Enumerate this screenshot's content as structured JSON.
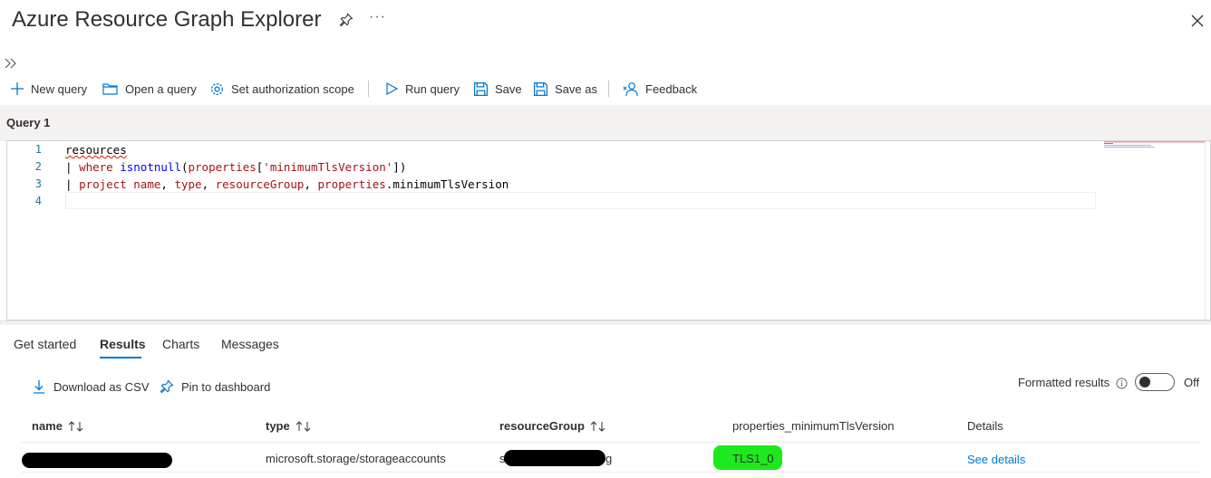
{
  "header": {
    "title": "Azure Resource Graph Explorer",
    "more_label": "···"
  },
  "toolbar": {
    "new_query": "New query",
    "open_query": "Open a query",
    "set_scope": "Set authorization scope",
    "run_query": "Run query",
    "save": "Save",
    "save_as": "Save as",
    "feedback": "Feedback"
  },
  "query_tab": {
    "label": "Query 1"
  },
  "editor": {
    "line_numbers": [
      "1",
      "2",
      "3",
      "4"
    ],
    "line1": "resources",
    "line2": {
      "pipe": "| ",
      "kw": "where",
      "fn": "isnotnull",
      "open": "(",
      "prop": "properties",
      "bracket_open": "[",
      "str": "'minimumTlsVersion'",
      "close": "])"
    },
    "line3": {
      "pipe": "| ",
      "kw": "project",
      "sp": " ",
      "a": "name",
      "c1": ", ",
      "b": "type",
      "c2": ", ",
      "c": "resourceGroup",
      "c3": ", ",
      "d": "properties",
      "e": ".minimumTlsVersion"
    }
  },
  "results_tabs": [
    "Get started",
    "Results",
    "Charts",
    "Messages"
  ],
  "actions": {
    "download_csv": "Download as CSV",
    "pin_dashboard": "Pin to dashboard"
  },
  "formatted": {
    "label": "Formatted results",
    "state_label": "Off",
    "enabled": false
  },
  "table": {
    "columns": [
      "name",
      "type",
      "resourceGroup",
      "properties_minimumTlsVersion",
      "Details"
    ],
    "rows": [
      {
        "name": "",
        "type": "microsoft.storage/storageaccounts",
        "resourceGroup_prefix": "s",
        "resourceGroup_suffix": "g",
        "tls": "TLS1_0",
        "details": "See details"
      }
    ]
  },
  "colors": {
    "accent": "#0078d4",
    "highlight": "#1ee81e",
    "redaction": "#000000"
  }
}
